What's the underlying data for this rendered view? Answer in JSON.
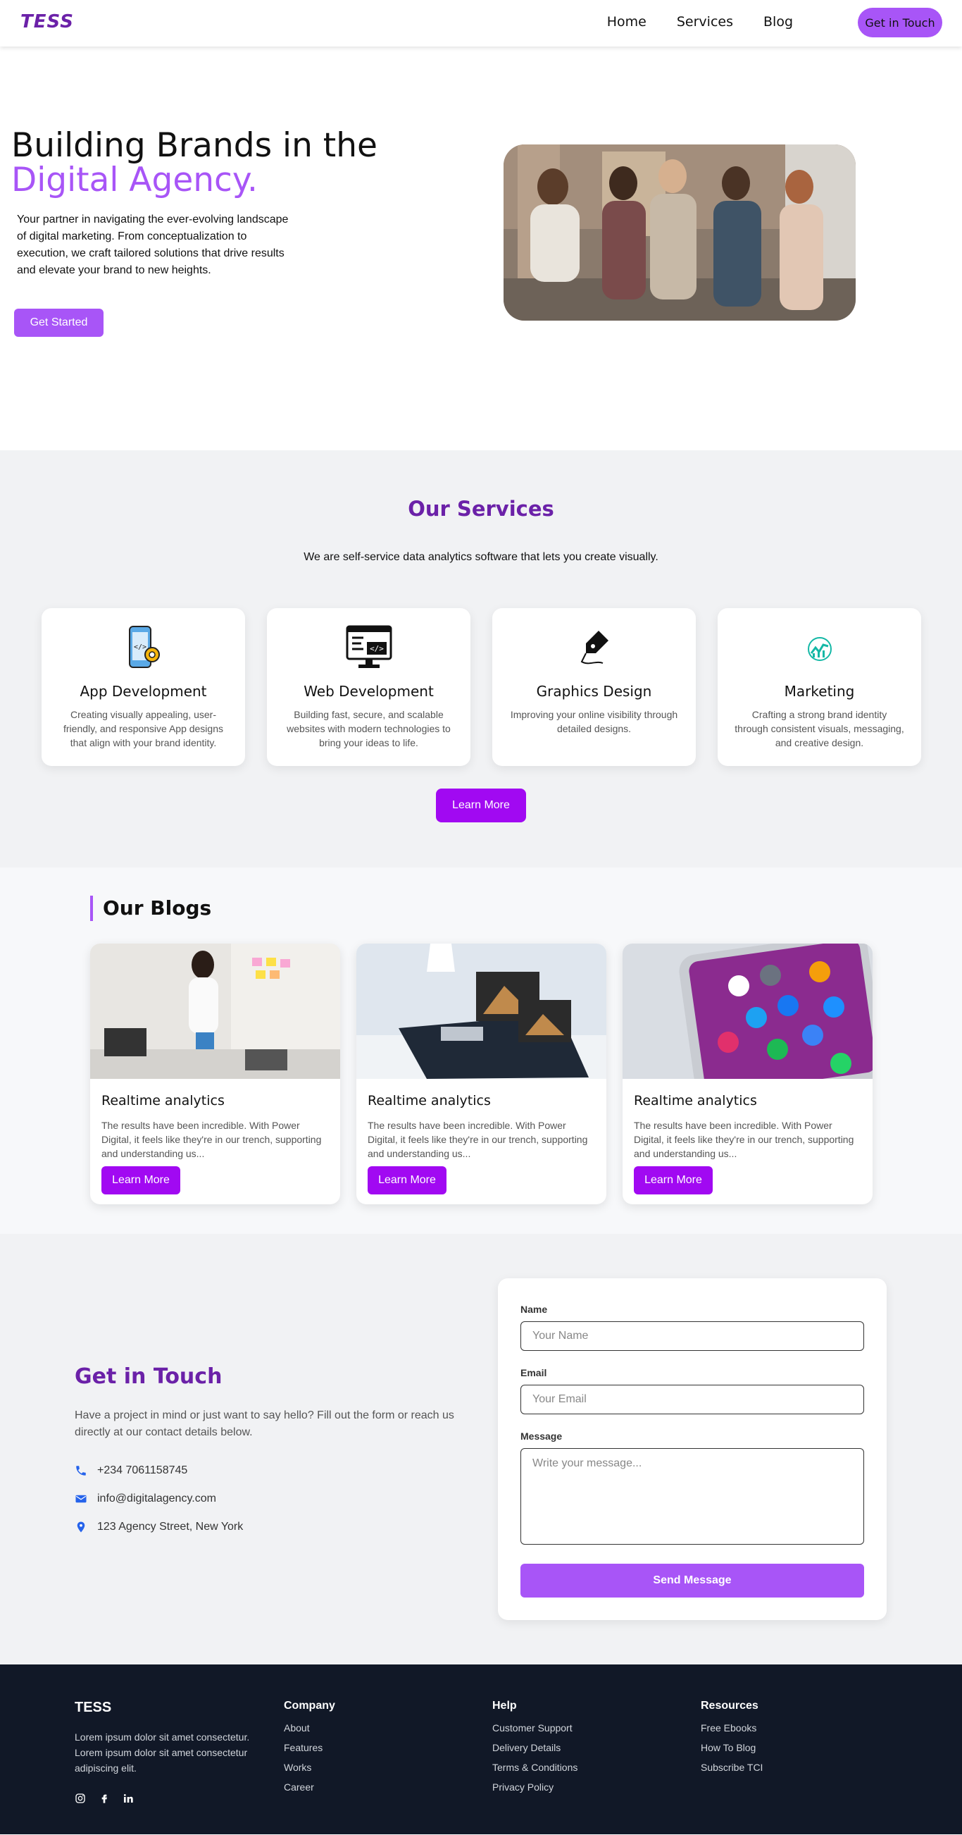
{
  "nav": {
    "logo": "TESS",
    "links": [
      "Home",
      "Services",
      "Blog"
    ],
    "cta": "Get in Touch"
  },
  "hero": {
    "title_line1": "Building Brands in the",
    "title_line2": "Digital Agency.",
    "description": "Your partner in navigating the ever-evolving landscape of digital marketing. From conceptualization to execution, we craft tailored solutions that drive results and elevate your brand to new heights.",
    "button": "Get Started"
  },
  "services": {
    "title": "Our Services",
    "subtitle": "We are self-service data analytics software that lets you create visually.",
    "cards": [
      {
        "title": "App Development",
        "desc": "Creating visually appealing, user-friendly, and responsive App designs that align with your brand identity.",
        "icon": "mobile-app-icon"
      },
      {
        "title": "Web Development",
        "desc": "Building fast, secure, and scalable websites with modern technologies to bring your ideas to life.",
        "icon": "web-code-icon"
      },
      {
        "title": "Graphics Design",
        "desc": "Improving your online visibility through detailed designs.",
        "icon": "pen-nib-icon"
      },
      {
        "title": "Marketing",
        "desc": "Crafting a strong brand identity through consistent visuals, messaging, and creative design.",
        "icon": "growth-chart-icon"
      }
    ],
    "button": "Learn More"
  },
  "blogs": {
    "title": "Our Blogs",
    "posts": [
      {
        "title": "Realtime analytics",
        "excerpt": "The results have been incredible. With Power Digital, it feels like they're in our trench, supporting and understanding us...",
        "button": "Learn More"
      },
      {
        "title": "Realtime analytics",
        "excerpt": "The results have been incredible. With Power Digital, it feels like they're in our trench, supporting and understanding us...",
        "button": "Learn More"
      },
      {
        "title": "Realtime analytics",
        "excerpt": "The results have been incredible. With Power Digital, it feels like they're in our trench, supporting and understanding us...",
        "button": "Learn More"
      }
    ]
  },
  "contact": {
    "title": "Get in Touch",
    "description": "Have a project in mind or just want to say hello? Fill out the form or reach us directly at our contact details below.",
    "phone": "+234 7061158745",
    "email": "info@digitalagency.com",
    "address": "123 Agency Street, New York",
    "form": {
      "name_label": "Name",
      "name_placeholder": "Your Name",
      "email_label": "Email",
      "email_placeholder": "Your Email",
      "message_label": "Message",
      "message_placeholder": "Write your message...",
      "submit": "Send Message"
    }
  },
  "footer": {
    "brand": "TESS",
    "description": "Lorem ipsum dolor sit amet consectetur. Lorem ipsum dolor sit amet consectetur adipiscing elit.",
    "social": [
      "instagram-icon",
      "facebook-icon",
      "linkedin-icon"
    ],
    "columns": [
      {
        "title": "Company",
        "links": [
          "About",
          "Features",
          "Works",
          "Career"
        ]
      },
      {
        "title": "Help",
        "links": [
          "Customer Support",
          "Delivery Details",
          "Terms & Conditions",
          "Privacy Policy"
        ]
      },
      {
        "title": "Resources",
        "links": [
          "Free Ebooks",
          "How To Blog",
          "Subscribe TCI"
        ]
      }
    ]
  },
  "colors": {
    "accent": "#a855f7",
    "accent_dark": "#a109f2",
    "heading_purple": "#6b21a8",
    "footer_bg": "#111827",
    "contact_icon": "#2563eb"
  }
}
